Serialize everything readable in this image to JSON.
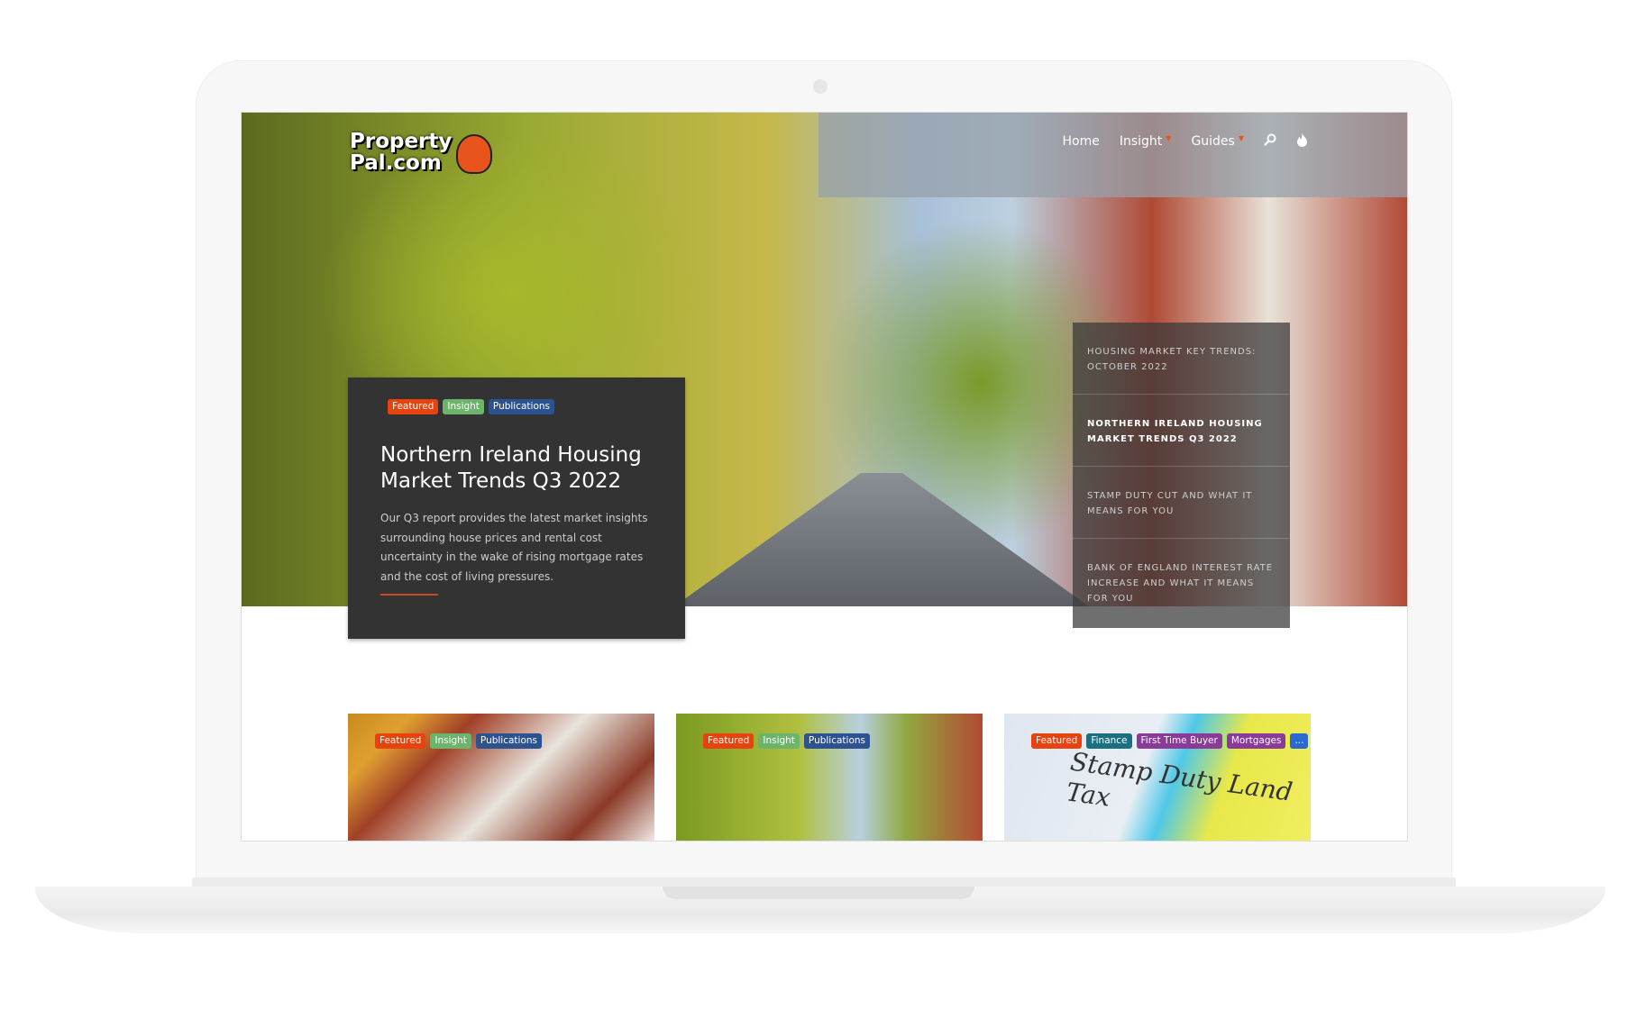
{
  "brand": {
    "logo_text_line1": "Property",
    "logo_text_line2": "Pal.com"
  },
  "nav": {
    "items": [
      {
        "label": "Home"
      },
      {
        "label": "Insight",
        "has_dropdown": true
      },
      {
        "label": "Guides",
        "has_dropdown": true
      }
    ],
    "icons": [
      "search-icon",
      "flame-icon"
    ]
  },
  "featured": {
    "tags": [
      "Featured",
      "Insight",
      "Publications"
    ],
    "title": "Northern Ireland Housing Market Trends Q3 2022",
    "summary": "Our Q3 report provides the latest market insights surrounding house prices and rental cost uncertainty in the wake of rising mortgage rates and the cost of living pressures."
  },
  "sidebar": {
    "items": [
      {
        "label": "Housing Market Key Trends: October 2022"
      },
      {
        "label": "Northern Ireland Housing Market Trends Q3 2022",
        "active": true
      },
      {
        "label": "Stamp Duty Cut and What It Means for You"
      },
      {
        "label": "Bank of England Interest Rate Increase and What It Means for You"
      }
    ]
  },
  "cards": [
    {
      "tags": [
        "Featured",
        "Insight",
        "Publications"
      ]
    },
    {
      "tags": [
        "Featured",
        "Insight",
        "Publications"
      ]
    },
    {
      "tags": [
        "Featured",
        "Finance",
        "First Time Buyer",
        "Mortgages",
        "..."
      ],
      "image_text": "Stamp Duty Land Tax"
    }
  ],
  "colors": {
    "accent": "#e8420e",
    "insight": "#6cb46c",
    "publications": "#2c5290",
    "card_bg": "#333333"
  }
}
